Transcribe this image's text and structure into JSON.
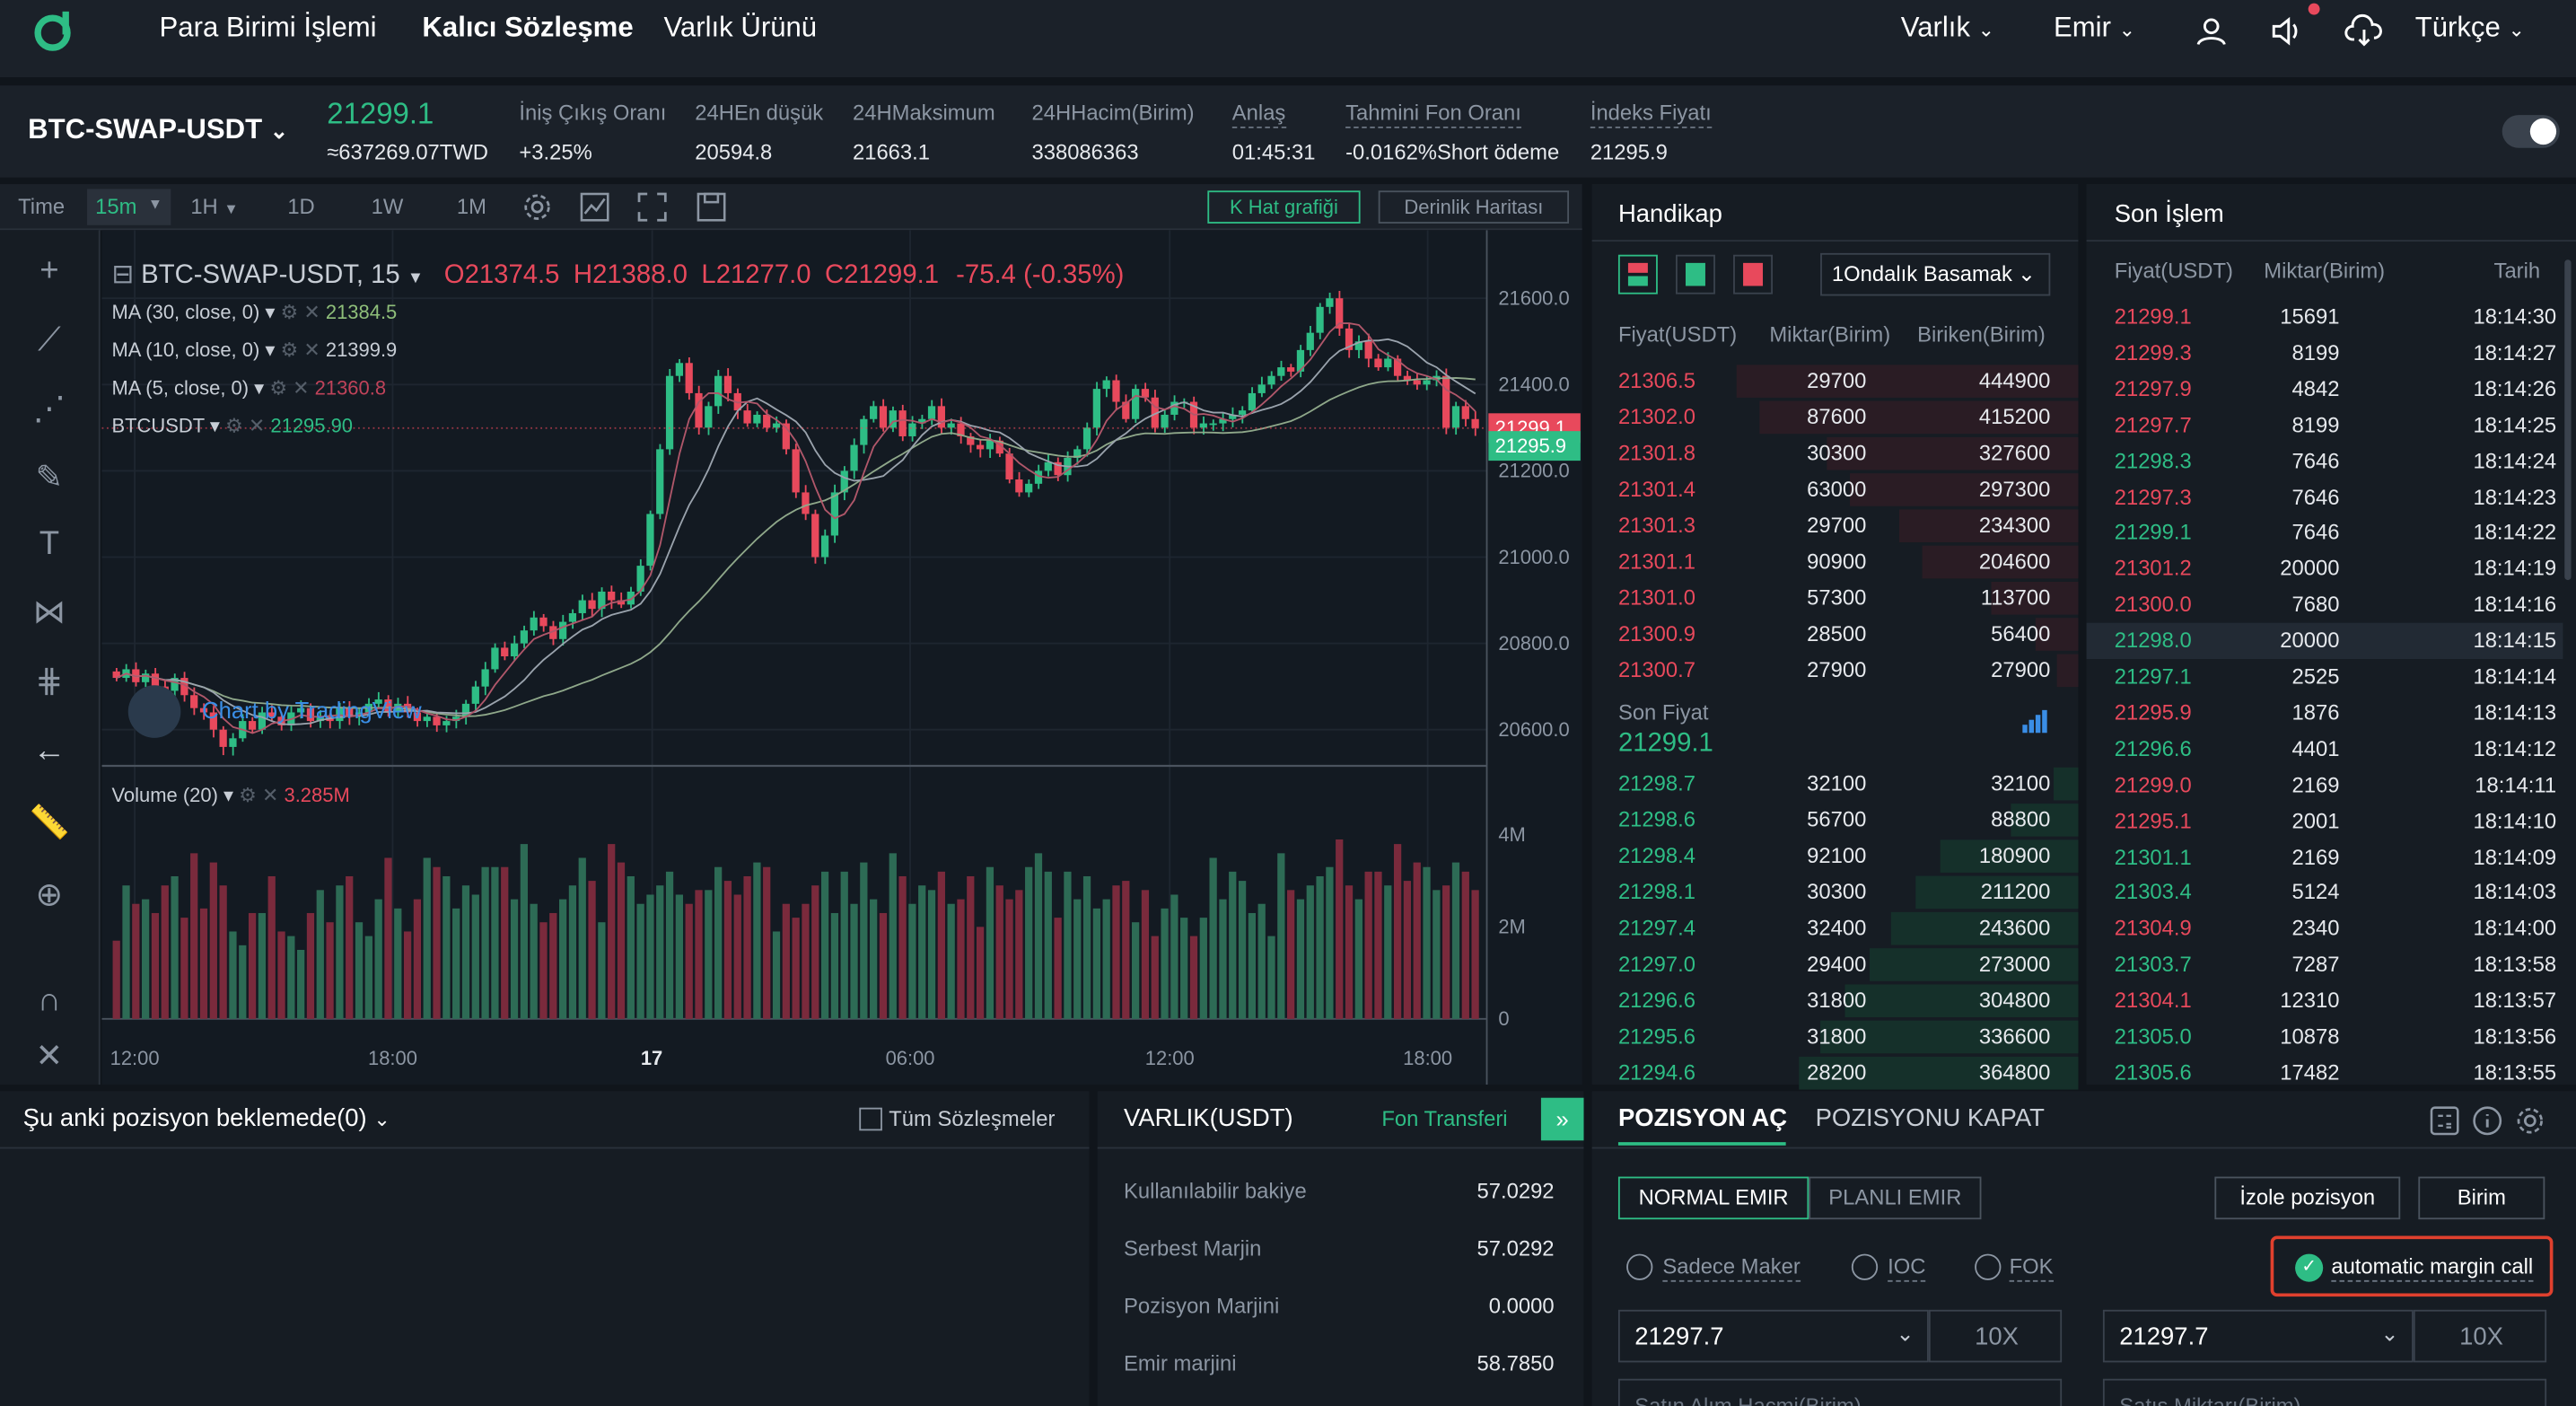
{
  "nav": {
    "items": [
      "Para Birimi İşlemi",
      "Kalıcı Sözleşme",
      "Varlık Ürünü"
    ],
    "right": [
      "Varlık",
      "Emir",
      "Türkçe"
    ]
  },
  "ticker": {
    "symbol": "BTC-SWAP-USDT",
    "price": "21299.1",
    "price_twd": "≈637269.07TWD",
    "stats": [
      {
        "label": "İniş Çıkış Oranı",
        "value": "+3.25%"
      },
      {
        "label": "24HEn düşük",
        "value": "20594.8"
      },
      {
        "label": "24HMaksimum",
        "value": "21663.1"
      },
      {
        "label": "24HHacim(Birim)",
        "value": "338086363"
      },
      {
        "label": "Anlaş",
        "value": "01:45:31"
      },
      {
        "label": "Tahmini Fon Oranı",
        "value": "-0.0162%Short ödeme"
      },
      {
        "label": "İndeks Fiyatı",
        "value": "21295.9"
      }
    ]
  },
  "chart_toolbar": {
    "time": "Time",
    "interval": "15m",
    "h1": "1H",
    "d1": "1D",
    "w1": "1W",
    "m1": "1M",
    "kline": "K Hat grafiği",
    "depth": "Derinlik Haritası"
  },
  "chart_legend": {
    "title": "BTC-SWAP-USDT, 15",
    "o": "O21374.5",
    "h": "H21388.0",
    "l": "L21277.0",
    "c": "C21299.1",
    "chg": "-75.4 (-0.35%)",
    "ma30": "MA (30, close, 0)",
    "ma30v": "21384.5",
    "ma10": "MA (10, close, 0)",
    "ma10v": "21399.9",
    "ma5": "MA (5, close, 0)",
    "ma5v": "21360.8",
    "idx": "BTCUSDT",
    "idxv": "21295.90",
    "vol": "Volume (20)",
    "volv": "3.285M",
    "watermark": "Chart by TradingView"
  },
  "chart_data": {
    "type": "candlestick",
    "x_ticks": [
      "12:00",
      "18:00",
      "17",
      "06:00",
      "12:00",
      "18:00"
    ],
    "y_ticks": [
      "21600.0",
      "21400.0",
      "21200.0",
      "21000.0",
      "20800.0",
      "20600.0"
    ],
    "ylim": [
      20520,
      21720
    ],
    "last_price": "21299.1",
    "index_price": "21295.9",
    "vol_ticks": [
      "4M",
      "2M",
      "0"
    ],
    "vol_ylim": [
      0,
      5000000
    ],
    "closes": [
      20720,
      20740,
      20710,
      20730,
      20700,
      20690,
      20720,
      20680,
      20650,
      20640,
      20600,
      20560,
      20580,
      20620,
      20600,
      20640,
      20630,
      20610,
      20640,
      20650,
      20620,
      20630,
      20620,
      20650,
      20630,
      20640,
      20660,
      20670,
      20640,
      20660,
      20640,
      20620,
      20630,
      20610,
      20620,
      20630,
      20660,
      20700,
      20740,
      20790,
      20770,
      20800,
      20830,
      20860,
      20840,
      20810,
      20850,
      20870,
      20900,
      20880,
      20920,
      20900,
      20890,
      20920,
      20980,
      21100,
      21250,
      21420,
      21450,
      21380,
      21300,
      21350,
      21420,
      21380,
      21340,
      21310,
      21330,
      21300,
      21310,
      21250,
      21150,
      21100,
      21000,
      21050,
      21150,
      21200,
      21260,
      21320,
      21350,
      21300,
      21340,
      21280,
      21310,
      21320,
      21350,
      21300,
      21310,
      21280,
      21260,
      21250,
      21270,
      21240,
      21180,
      21150,
      21170,
      21200,
      21220,
      21190,
      21230,
      21250,
      21300,
      21390,
      21410,
      21360,
      21320,
      21390,
      21370,
      21300,
      21330,
      21360,
      21360,
      21300,
      21310,
      21310,
      21320,
      21330,
      21340,
      21380,
      21400,
      21420,
      21440,
      21430,
      21480,
      21520,
      21580,
      21600,
      21530,
      21480,
      21500,
      21460,
      21440,
      21460,
      21420,
      21410,
      21400,
      21410,
      21420,
      21300,
      21350,
      21320,
      21299
    ],
    "volumes": [
      1.7,
      2.9,
      2.5,
      2.6,
      2.3,
      2.9,
      3.1,
      2.2,
      3.6,
      2.4,
      3.4,
      2.9,
      1.9,
      1.6,
      2.3,
      2.3,
      3.1,
      1.9,
      1.8,
      1.5,
      2.3,
      2.8,
      2.1,
      2.9,
      3.1,
      2.1,
      1.8,
      2.6,
      3.5,
      2.4,
      1.9,
      2.6,
      3.5,
      3.3,
      3.1,
      2.4,
      2.9,
      2.7,
      3.3,
      3.3,
      3.3,
      2.6,
      3.8,
      2.5,
      2.1,
      2.3,
      2.6,
      2.9,
      3.5,
      3.0,
      2.1,
      3.8,
      3.4,
      3.1,
      2.5,
      2.7,
      2.9,
      3.2,
      2.7,
      2.5,
      2.8,
      2.8,
      3.3,
      3.0,
      2.7,
      3.1,
      3.4,
      3.3,
      1.9,
      2.5,
      2.2,
      2.5,
      2.9,
      3.2,
      2.3,
      3.2,
      2.5,
      3.4,
      2.6,
      2.3,
      3.6,
      3.1,
      2.5,
      2.9,
      2.8,
      3.2,
      2.5,
      2.6,
      3.1,
      2.0,
      3.3,
      2.9,
      2.6,
      2.8,
      3.3,
      3.6,
      3.2,
      2.2,
      3.2,
      2.6,
      3.1,
      2.4,
      2.6,
      2.9,
      3.0,
      2.1,
      2.8,
      1.8,
      2.4,
      2.7,
      2.2,
      1.8,
      2.2,
      3.5,
      2.6,
      3.2,
      3.0,
      2.3,
      2.5,
      1.8,
      3.6,
      2.8,
      2.6,
      2.9,
      3.1,
      3.3,
      3.9,
      2.9,
      2.6,
      3.2,
      3.2,
      2.9,
      3.8,
      3.0,
      3.4,
      3.3,
      2.8,
      2.9,
      3.4,
      3.2,
      2.8,
      3.7,
      3.3,
      3.1,
      3.3
    ]
  },
  "orderbook": {
    "title": "Handikap",
    "decimal": "1Ondalık Basamak",
    "cols": [
      "Fiyat(USDT)",
      "Miktar(Birim)",
      "Biriken(Birim)"
    ],
    "asks": [
      [
        "21306.5",
        "29700",
        "444900"
      ],
      [
        "21302.0",
        "87600",
        "415200"
      ],
      [
        "21301.8",
        "30300",
        "327600"
      ],
      [
        "21301.4",
        "63000",
        "297300"
      ],
      [
        "21301.3",
        "29700",
        "234300"
      ],
      [
        "21301.1",
        "90900",
        "204600"
      ],
      [
        "21301.0",
        "57300",
        "113700"
      ],
      [
        "21300.9",
        "28500",
        "56400"
      ],
      [
        "21300.7",
        "27900",
        "27900"
      ]
    ],
    "last_label": "Son Fiyat",
    "last": "21299.1",
    "bids": [
      [
        "21298.7",
        "32100",
        "32100"
      ],
      [
        "21298.6",
        "56700",
        "88800"
      ],
      [
        "21298.4",
        "92100",
        "180900"
      ],
      [
        "21298.1",
        "30300",
        "211200"
      ],
      [
        "21297.4",
        "32400",
        "243600"
      ],
      [
        "21297.0",
        "29400",
        "273000"
      ],
      [
        "21296.6",
        "31800",
        "304800"
      ],
      [
        "21295.6",
        "31800",
        "336600"
      ],
      [
        "21294.6",
        "28200",
        "364800"
      ]
    ]
  },
  "trades": {
    "title": "Son İşlem",
    "cols": [
      "Fiyat(USDT)",
      "Miktar(Birim)",
      "Tarih"
    ],
    "rows": [
      [
        "21299.1",
        "15691",
        "18:14:30",
        "r"
      ],
      [
        "21299.3",
        "8199",
        "18:14:27",
        "r"
      ],
      [
        "21297.9",
        "4842",
        "18:14:26",
        "r"
      ],
      [
        "21297.7",
        "8199",
        "18:14:25",
        "r"
      ],
      [
        "21298.3",
        "7646",
        "18:14:24",
        "g"
      ],
      [
        "21297.3",
        "7646",
        "18:14:23",
        "r"
      ],
      [
        "21299.1",
        "7646",
        "18:14:22",
        "g"
      ],
      [
        "21301.2",
        "20000",
        "18:14:19",
        "r"
      ],
      [
        "21300.0",
        "7680",
        "18:14:16",
        "r"
      ],
      [
        "21298.0",
        "20000",
        "18:14:15",
        "g"
      ],
      [
        "21297.1",
        "2525",
        "18:14:14",
        "g"
      ],
      [
        "21295.9",
        "1876",
        "18:14:13",
        "r"
      ],
      [
        "21296.6",
        "4401",
        "18:14:12",
        "g"
      ],
      [
        "21299.0",
        "2169",
        "18:14:11",
        "r"
      ],
      [
        "21295.1",
        "2001",
        "18:14:10",
        "r"
      ],
      [
        "21301.1",
        "2169",
        "18:14:09",
        "g"
      ],
      [
        "21303.4",
        "5124",
        "18:14:03",
        "g"
      ],
      [
        "21304.9",
        "2340",
        "18:14:00",
        "r"
      ],
      [
        "21303.7",
        "7287",
        "18:13:58",
        "g"
      ],
      [
        "21304.1",
        "12310",
        "18:13:57",
        "r"
      ],
      [
        "21305.0",
        "10878",
        "18:13:56",
        "g"
      ],
      [
        "21305.6",
        "17482",
        "18:13:55",
        "g"
      ]
    ]
  },
  "positions": {
    "title": "Şu anki pozisyon beklemede(0)",
    "all": "Tüm Sözleşmeler"
  },
  "assets": {
    "title": "VARLIK(USDT)",
    "transfer": "Fon Transferi",
    "rows": [
      [
        "Kullanılabilir bakiye",
        "57.0292"
      ],
      [
        "Serbest Marjin",
        "57.0292"
      ],
      [
        "Pozisyon Marjini",
        "0.0000"
      ],
      [
        "Emir marjini",
        "58.7850"
      ]
    ]
  },
  "order": {
    "tab_open": "POZISYON AÇ",
    "tab_close": "POZISYONU KAPAT",
    "normal": "NORMAL EMIR",
    "plan": "PLANLI EMIR",
    "isolate": "İzole pozisyon",
    "unit": "Birim",
    "maker": "Sadece Maker",
    "ioc": "IOC",
    "fok": "FOK",
    "auto_margin": "automatic margin call",
    "price1": "21297.7",
    "lev1": "10X",
    "price2": "21297.7",
    "lev2": "10X",
    "buy_label": "Satın Alım Hacmi(Birim)",
    "sell_label": "Satış Miktarı(Birim)"
  }
}
